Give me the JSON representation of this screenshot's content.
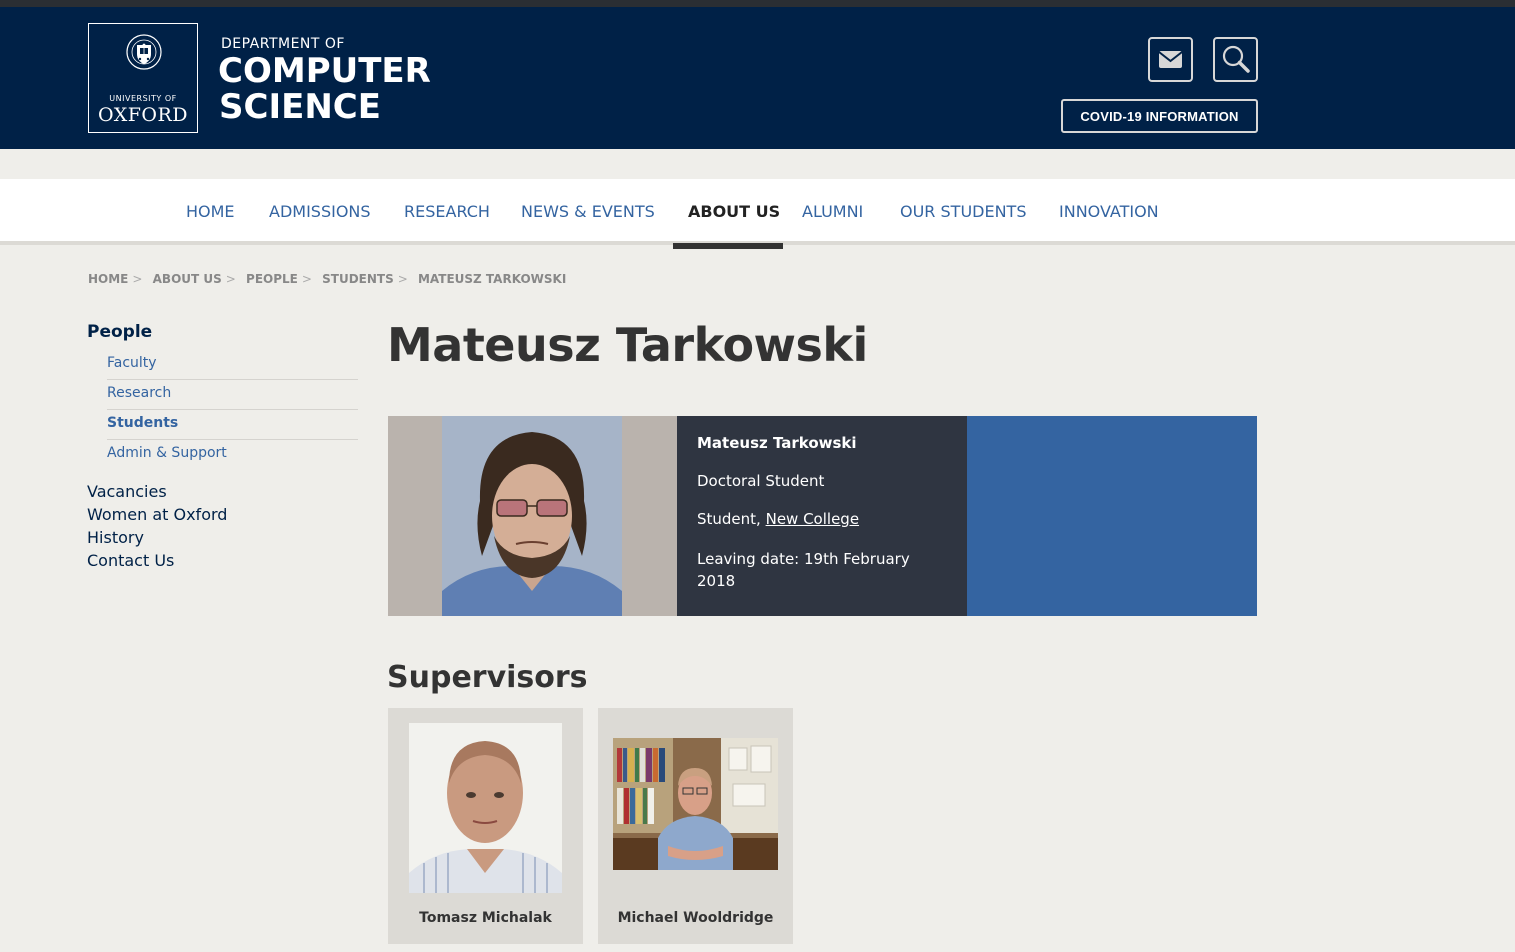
{
  "header": {
    "logo": {
      "university_of": "UNIVERSITY OF",
      "oxford": "OXFORD"
    },
    "department_of": "DEPARTMENT OF",
    "computer": "COMPUTER",
    "science": "SCIENCE",
    "email_icon": "envelope-icon",
    "search_icon": "magnifier-icon",
    "covid_label": "COVID-19 INFORMATION"
  },
  "nav": {
    "items": [
      {
        "label": "HOME"
      },
      {
        "label": "ADMISSIONS"
      },
      {
        "label": "RESEARCH"
      },
      {
        "label": "NEWS & EVENTS"
      },
      {
        "label": "ABOUT US",
        "active": true
      },
      {
        "label": "ALUMNI"
      },
      {
        "label": "OUR STUDENTS"
      },
      {
        "label": "INNOVATION"
      }
    ]
  },
  "breadcrumb": [
    "HOME",
    "ABOUT US",
    "PEOPLE",
    "STUDENTS",
    "MATEUSZ TARKOWSKI"
  ],
  "sidebar": {
    "heading": "People",
    "subitems": [
      "Faculty",
      "Research",
      "Students",
      "Admin & Support"
    ],
    "current_subitem": "Students",
    "links": [
      "Vacancies",
      "Women at Oxford",
      "History",
      "Contact Us"
    ]
  },
  "profile": {
    "title": "Mateusz Tarkowski",
    "name": "Mateusz Tarkowski",
    "role": "Doctoral Student",
    "college_prefix": "Student, ",
    "college_link": "New College",
    "leaving": "Leaving date: 19th February 2018"
  },
  "supervisors": {
    "heading": "Supervisors",
    "people": [
      {
        "name": "Tomasz Michalak"
      },
      {
        "name": "Michael Wooldridge"
      }
    ]
  },
  "colors": {
    "header_bg": "#002147",
    "link_blue": "#3464a1",
    "info_dark": "#2f3541",
    "page_bg": "#efeeea"
  }
}
